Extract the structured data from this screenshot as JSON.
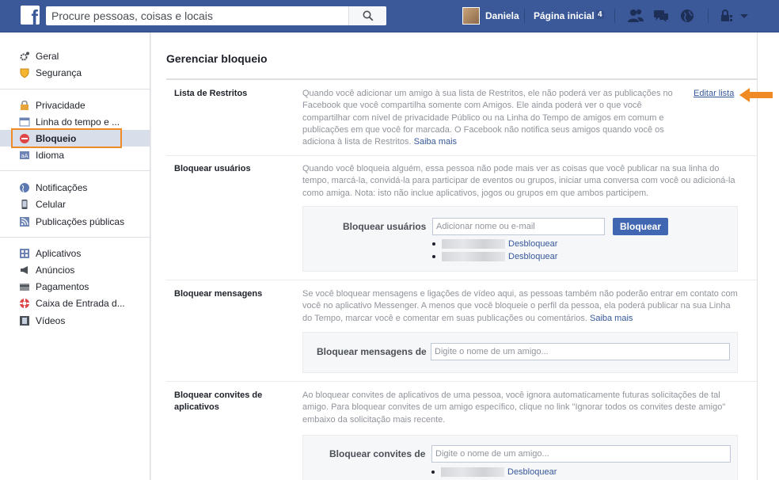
{
  "topbar": {
    "logo_letter": "f",
    "search_placeholder": "Procure pessoas, coisas e locais",
    "username": "Daniela",
    "home_label": "Página inicial",
    "home_count": "4"
  },
  "sidebar": {
    "items": [
      {
        "label": "Geral",
        "icon": "gear-icon"
      },
      {
        "label": "Segurança",
        "icon": "shield-icon"
      },
      {
        "label": "Privacidade",
        "icon": "lock-icon"
      },
      {
        "label": "Linha do tempo e ...",
        "icon": "timeline-icon"
      },
      {
        "label": "Bloqueio",
        "icon": "block-icon"
      },
      {
        "label": "Idioma",
        "icon": "language-icon"
      },
      {
        "label": "Notificações",
        "icon": "globe-icon"
      },
      {
        "label": "Celular",
        "icon": "phone-icon"
      },
      {
        "label": "Publicações públicas",
        "icon": "rss-icon"
      },
      {
        "label": "Aplicativos",
        "icon": "apps-icon"
      },
      {
        "label": "Anúncios",
        "icon": "ads-icon"
      },
      {
        "label": "Pagamentos",
        "icon": "card-icon"
      },
      {
        "label": "Caixa de Entrada d...",
        "icon": "lifebuoy-icon"
      },
      {
        "label": "Vídeos",
        "icon": "film-icon"
      }
    ],
    "active_index": 4
  },
  "content": {
    "title": "Gerenciar bloqueio",
    "restricted": {
      "label": "Lista de Restritos",
      "desc": "Quando você adicionar um amigo à sua lista de Restritos, ele não poderá ver as publicações no Facebook que você compartilha somente com Amigos. Ele ainda poderá ver o que você compartilhar com nível de privacidade Público ou na Linha do Tempo de amigos em comum e publicações em que você for marcada. O Facebook não notifica seus amigos quando você os adiciona à lista de Restritos.",
      "more_link": "Saiba mais",
      "edit_link": "Editar lista"
    },
    "block_users": {
      "label": "Bloquear usuários",
      "desc": "Quando você bloqueia alguém, essa pessoa não pode mais ver as coisas que você publicar na sua linha do tempo, marcá-la, convidá-la para participar de eventos ou grupos, iniciar uma conversa com você ou adicioná-la como amiga. Nota: isto não inclue aplicativos, jogos ou grupos em que ambos participem.",
      "panel_label": "Bloquear usuários",
      "input_placeholder": "Adicionar nome ou e-mail",
      "button_label": "Bloquear",
      "unblock_label": "Desbloquear"
    },
    "block_messages": {
      "label": "Bloquear mensagens",
      "desc": "Se você bloquear mensagens e ligações de vídeo aqui, as pessoas também não poderão entrar em contato com você no aplicativo Messenger. A menos que você bloqueie o perfil da pessoa, ela poderá publicar na sua Linha do Tempo, marcar você e comentar em suas publicações ou comentários.",
      "more_link": "Saiba mais",
      "panel_label": "Bloquear mensagens de",
      "input_placeholder": "Digite o nome de um amigo..."
    },
    "block_app_invites": {
      "label": "Bloquear convites de aplicativos",
      "desc": "Ao bloquear convites de aplicativos de uma pessoa, você ignora automaticamente futuras solicitações de tal amigo. Para bloquear convites de um amigo específico, clique no link \"Ignorar todos os convites deste amigo\" embaixo da solicitação mais recente.",
      "panel_label": "Bloquear convites de",
      "input_placeholder": "Digite o nome de um amigo...",
      "unblock_label": "Desbloquear"
    }
  },
  "colors": {
    "brand": "#3b5998",
    "link": "#365899",
    "highlight": "#f08a24"
  }
}
